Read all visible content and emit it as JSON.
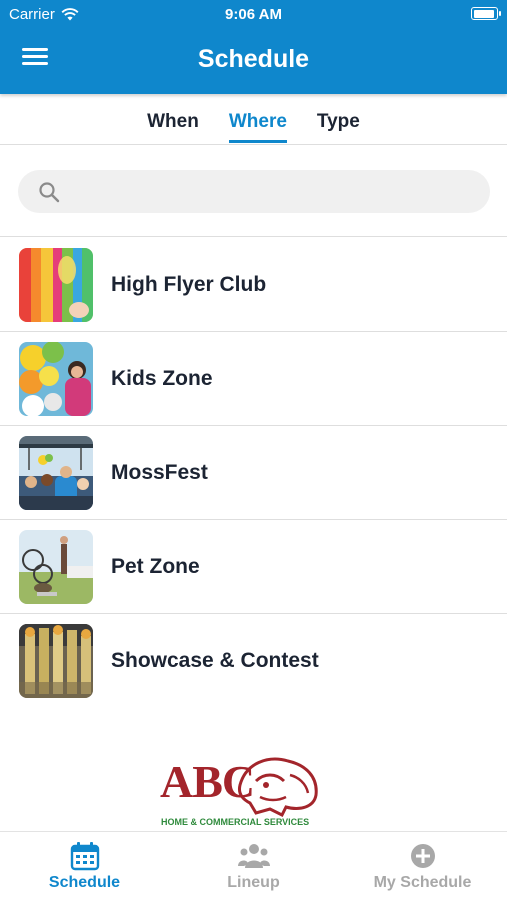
{
  "status": {
    "carrier": "Carrier",
    "time": "9:06 AM"
  },
  "header": {
    "title": "Schedule"
  },
  "tabs": [
    {
      "label": "When",
      "active": false
    },
    {
      "label": "Where",
      "active": true
    },
    {
      "label": "Type",
      "active": false
    }
  ],
  "search": {
    "placeholder": ""
  },
  "locations": [
    {
      "label": "High Flyer Club",
      "thumb": "balloons-colorful"
    },
    {
      "label": "Kids Zone",
      "thumb": "balloons-child"
    },
    {
      "label": "MossFest",
      "thumb": "crowd-festival"
    },
    {
      "label": "Pet Zone",
      "thumb": "dog-agility"
    },
    {
      "label": "Showcase & Contest",
      "thumb": "trophies"
    }
  ],
  "sponsor": {
    "logo_text": "ABC",
    "tagline": "HOME & COMMERCIAL SERVICES"
  },
  "tabbar": {
    "items": [
      {
        "label": "Schedule",
        "icon": "calendar-icon",
        "active": true
      },
      {
        "label": "Lineup",
        "icon": "people-icon",
        "active": false
      },
      {
        "label": "My Schedule",
        "icon": "plus-circle-icon",
        "active": false
      }
    ]
  },
  "colors": {
    "primary": "#0f87cc",
    "text": "#1c2433",
    "inactive": "#a8a8a8",
    "sponsor_red": "#a3252b",
    "sponsor_green": "#2f8a3c"
  }
}
